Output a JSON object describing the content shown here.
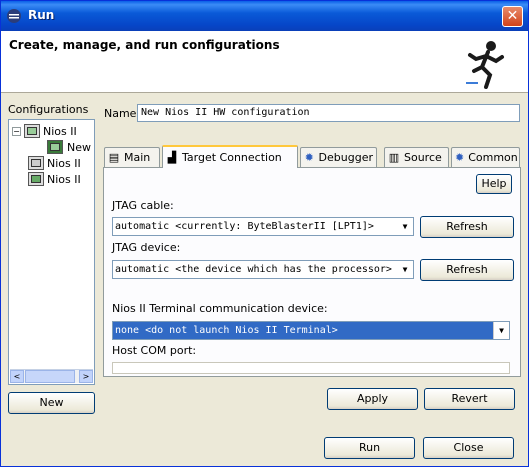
{
  "window": {
    "title": "Run",
    "close_glyph": "✕"
  },
  "banner": {
    "heading": "Create, manage, and run configurations"
  },
  "left": {
    "label": "Configurations",
    "tree": [
      {
        "text": "Nios II",
        "expander": "−"
      },
      {
        "text": "New"
      },
      {
        "text": "Nios II"
      },
      {
        "text": "Nios II"
      }
    ],
    "scroll_left": "<",
    "scroll_right": ">",
    "new_button": "New"
  },
  "name": {
    "label": "Name:",
    "value": "New Nios II HW configuration"
  },
  "tabs": [
    {
      "label": "Main",
      "icon": "document-icon"
    },
    {
      "label": "Target Connection",
      "icon": "hardware-icon"
    },
    {
      "label": "Debugger",
      "icon": "bug-icon"
    },
    {
      "label": "Source",
      "icon": "source-icon"
    },
    {
      "label": "Common",
      "icon": "gear-icon"
    }
  ],
  "panel": {
    "help": "Help",
    "jtag_cable_label": "JTAG cable:",
    "jtag_cable_value": "automatic <currently: ByteBlasterII [LPT1]>",
    "jtag_device_label": "JTAG device:",
    "jtag_device_value": "automatic <the device which has the processor>",
    "refresh": "Refresh",
    "terminal_label": "Nios II Terminal communication device:",
    "terminal_value": "none <do not launch Nios II Terminal>",
    "com_port_label": "Host COM port:",
    "com_port_value": ""
  },
  "buttons": {
    "apply": "Apply",
    "revert": "Revert",
    "run": "Run",
    "close": "Close"
  }
}
